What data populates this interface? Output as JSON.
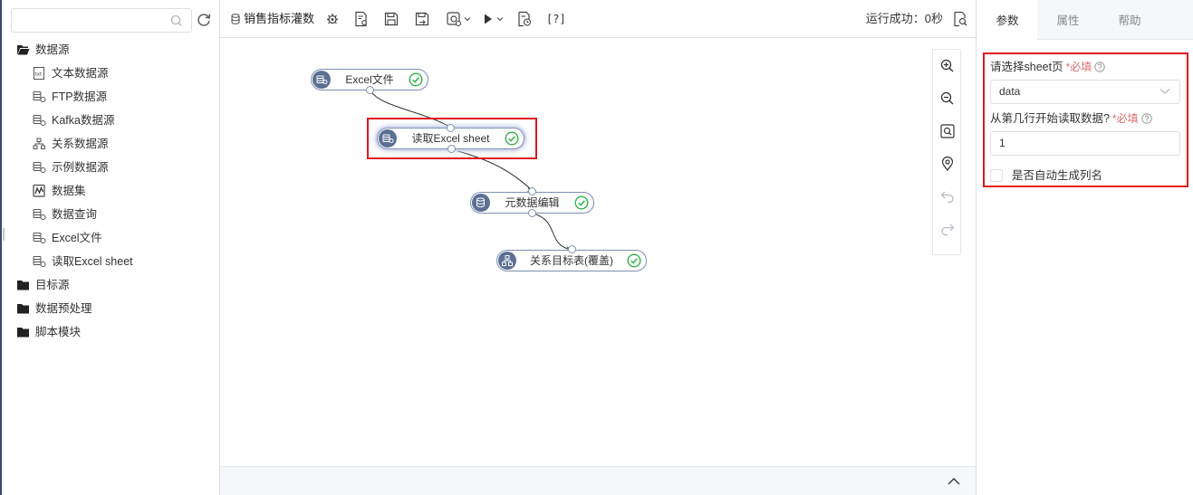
{
  "sidebar": {
    "search": {
      "value": "",
      "placeholder": ""
    },
    "tree": [
      {
        "label": "数据源",
        "icon": "folder-open-icon",
        "children": [
          {
            "label": "文本数据源",
            "icon": "txt-file-icon"
          },
          {
            "label": "FTP数据源",
            "icon": "database-gear-icon"
          },
          {
            "label": "Kafka数据源",
            "icon": "database-gear-icon"
          },
          {
            "label": "关系数据源",
            "icon": "relation-tree-icon"
          },
          {
            "label": "示例数据源",
            "icon": "database-gear-icon"
          },
          {
            "label": "数据集",
            "icon": "dataset-chart-icon"
          },
          {
            "label": "数据查询",
            "icon": "database-gear-icon"
          },
          {
            "label": "Excel文件",
            "icon": "database-gear-icon"
          },
          {
            "label": "读取Excel sheet",
            "icon": "database-gear-icon"
          }
        ]
      },
      {
        "label": "目标源",
        "icon": "folder-icon"
      },
      {
        "label": "数据预处理",
        "icon": "folder-icon"
      },
      {
        "label": "脚本模块",
        "icon": "folder-icon"
      }
    ]
  },
  "toolbar": {
    "flow_title": "销售指标灌数",
    "help_text": "[?]",
    "run_status": "运行成功：0秒"
  },
  "canvas": {
    "nodes": [
      {
        "label": "Excel文件",
        "icon": "database-gear-icon",
        "status": "success"
      },
      {
        "label": "读取Excel sheet",
        "icon": "database-gear-icon",
        "status": "success",
        "selected": true
      },
      {
        "label": "元数据编辑",
        "icon": "database-edit-icon",
        "status": "success"
      },
      {
        "label": "关系目标表(覆盖)",
        "icon": "relation-tree-icon",
        "status": "success"
      }
    ]
  },
  "right_panel": {
    "tabs": [
      {
        "label": "参数",
        "active": true
      },
      {
        "label": "属性",
        "active": false
      },
      {
        "label": "帮助",
        "active": false
      }
    ],
    "fields": {
      "sheet": {
        "label": "请选择sheet页",
        "required": "*必填",
        "value": "data"
      },
      "start_row": {
        "label": "从第几行开始读取数据?",
        "required": "*必填",
        "value": "1"
      },
      "auto_columns": {
        "label": "是否自动生成列名",
        "checked": false
      }
    }
  },
  "colors": {
    "highlight": "#e0161e",
    "node_icon": "#5c6f94",
    "success": "#2fb34a",
    "node_border": "#7d8fb3"
  }
}
